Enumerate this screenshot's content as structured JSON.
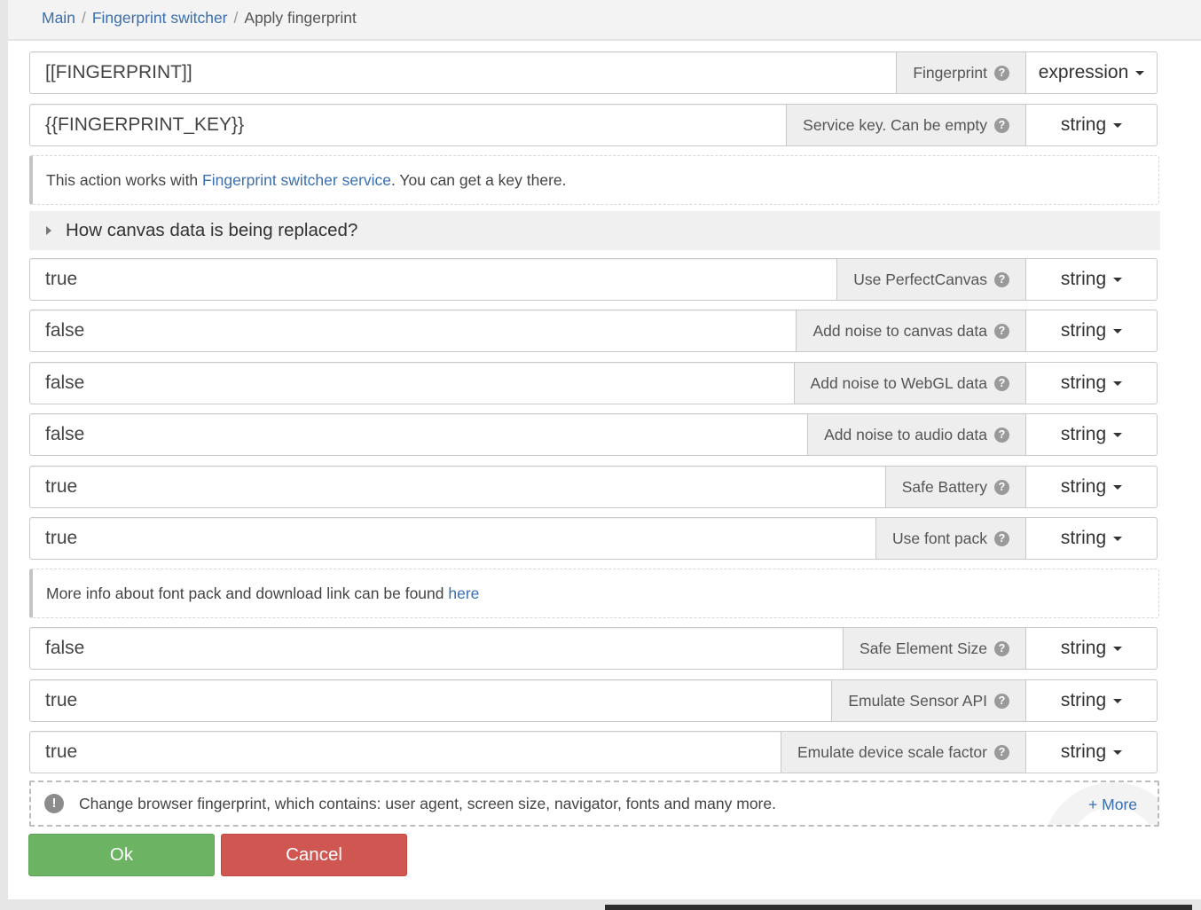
{
  "breadcrumb": {
    "items": [
      "Main",
      "Fingerprint switcher",
      "Apply fingerprint"
    ],
    "separator": "/"
  },
  "params": [
    {
      "value": "[[FINGERPRINT]]",
      "label": "Fingerprint",
      "type": "expression"
    },
    {
      "value": "{{FINGERPRINT_KEY}}",
      "label": "Service key. Can be empty",
      "type": "string"
    },
    {
      "value": "true",
      "label": "Use PerfectCanvas",
      "type": "string"
    },
    {
      "value": "false",
      "label": "Add noise to canvas data",
      "type": "string"
    },
    {
      "value": "false",
      "label": "Add noise to WebGL data",
      "type": "string"
    },
    {
      "value": "false",
      "label": "Add noise to audio data",
      "type": "string"
    },
    {
      "value": "true",
      "label": "Safe Battery",
      "type": "string"
    },
    {
      "value": "true",
      "label": "Use font pack",
      "type": "string"
    },
    {
      "value": "false",
      "label": "Safe Element Size",
      "type": "string"
    },
    {
      "value": "true",
      "label": "Emulate Sensor API",
      "type": "string"
    },
    {
      "value": "true",
      "label": "Emulate device scale factor",
      "type": "string"
    }
  ],
  "service_info": {
    "prefix": "This action works with ",
    "link": "Fingerprint switcher service",
    "suffix": ". You can get a key there."
  },
  "canvas_section": {
    "title": "How canvas data is being replaced?"
  },
  "font_info": {
    "text": "More info about font pack and download link can be found ",
    "link": "here"
  },
  "description": {
    "text": "Change browser fingerprint, which contains: user agent, screen size, navigator, fonts and many more.",
    "more": "+ More"
  },
  "buttons": {
    "ok": "Ok",
    "cancel": "Cancel"
  },
  "icons": {
    "help": "question-circle-icon",
    "info": "exclamation-circle-icon",
    "expand": "caret-right-icon",
    "dropdown": "caret-down-icon"
  },
  "colors": {
    "link": "#3a6fae",
    "ok": "#6cb364",
    "cancel": "#cf5651"
  }
}
